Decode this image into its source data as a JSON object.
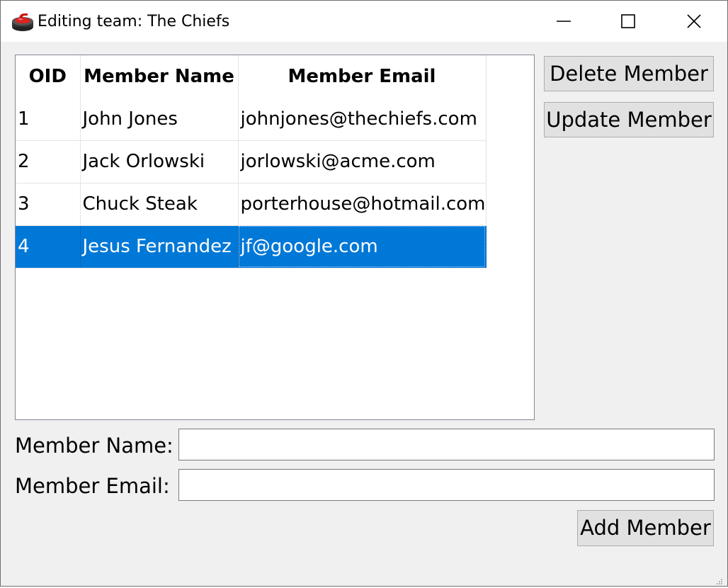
{
  "window": {
    "title": "Editing team: The Chiefs",
    "app_icon": "curling-stone-icon",
    "controls": [
      "minimize-icon",
      "maximize-icon",
      "close-icon"
    ]
  },
  "table": {
    "columns": [
      "OID",
      "Member Name",
      "Member Email"
    ],
    "rows": [
      {
        "oid": "1",
        "name": "John Jones",
        "email": "johnjones@thechiefs.com"
      },
      {
        "oid": "2",
        "name": "Jack Orlowski",
        "email": "jorlowski@acme.com"
      },
      {
        "oid": "3",
        "name": "Chuck Steak",
        "email": "porterhouse@hotmail.com"
      },
      {
        "oid": "4",
        "name": "Jesus Fernandez",
        "email": "jf@google.com"
      }
    ],
    "selected_row_index": 3
  },
  "buttons": {
    "delete": "Delete Member",
    "update": "Update Member",
    "add": "Add Member"
  },
  "form": {
    "name_label": "Member Name:",
    "name_value": "",
    "email_label": "Member Email:",
    "email_value": ""
  },
  "colors": {
    "selection": "#0078d7",
    "window_bg": "#f0f0f0",
    "button_bg": "#e1e1e1"
  }
}
